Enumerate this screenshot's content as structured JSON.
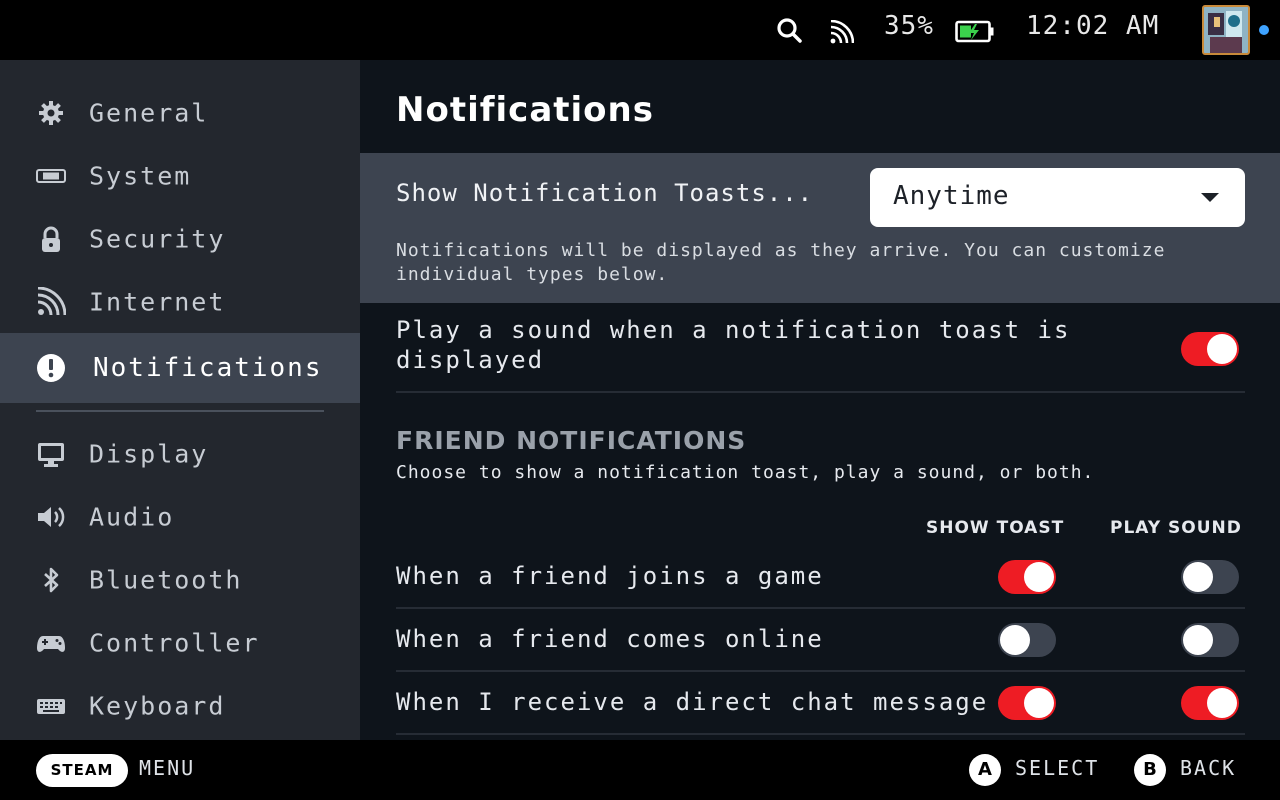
{
  "topbar": {
    "battery_percent": "35%",
    "time": "12:02 AM",
    "icons": [
      "search-icon",
      "wifi-icon",
      "battery-charging-icon"
    ]
  },
  "sidebar": {
    "items": [
      {
        "label": "General",
        "icon": "gear-icon"
      },
      {
        "label": "System",
        "icon": "device-icon"
      },
      {
        "label": "Security",
        "icon": "lock-icon"
      },
      {
        "label": "Internet",
        "icon": "signal-icon"
      },
      {
        "label": "Notifications",
        "icon": "alert-icon",
        "active": true
      },
      {
        "label": "Display",
        "icon": "monitor-icon"
      },
      {
        "label": "Audio",
        "icon": "speaker-icon"
      },
      {
        "label": "Bluetooth",
        "icon": "bluetooth-icon"
      },
      {
        "label": "Controller",
        "icon": "gamepad-icon"
      },
      {
        "label": "Keyboard",
        "icon": "keyboard-icon"
      }
    ]
  },
  "main": {
    "title": "Notifications",
    "toasts": {
      "label": "Show Notification Toasts...",
      "selected": "Anytime",
      "description": "Notifications will be displayed as they arrive. You can customize individual types below."
    },
    "sound_setting": {
      "label": "Play a sound when a notification toast is displayed",
      "enabled": true
    },
    "friend_section": {
      "header": "FRIEND NOTIFICATIONS",
      "description": "Choose to show a notification toast, play a sound, or both.",
      "col_show_toast": "SHOW TOAST",
      "col_play_sound": "PLAY SOUND",
      "rows": [
        {
          "label": "When a friend joins a game",
          "show_toast": true,
          "play_sound": false
        },
        {
          "label": "When a friend comes online",
          "show_toast": false,
          "play_sound": false
        },
        {
          "label": "When I receive a direct chat message",
          "show_toast": true,
          "play_sound": true
        }
      ]
    }
  },
  "bottombar": {
    "steam_label": "STEAM",
    "menu_label": "MENU",
    "a_button": "A",
    "select_label": "SELECT",
    "b_button": "B",
    "back_label": "BACK"
  },
  "colors": {
    "accent_toggle_on": "#ee1c24",
    "sidebar_bg": "#23272e",
    "main_bg": "#0e141b",
    "highlight_bg": "#3d4450"
  }
}
